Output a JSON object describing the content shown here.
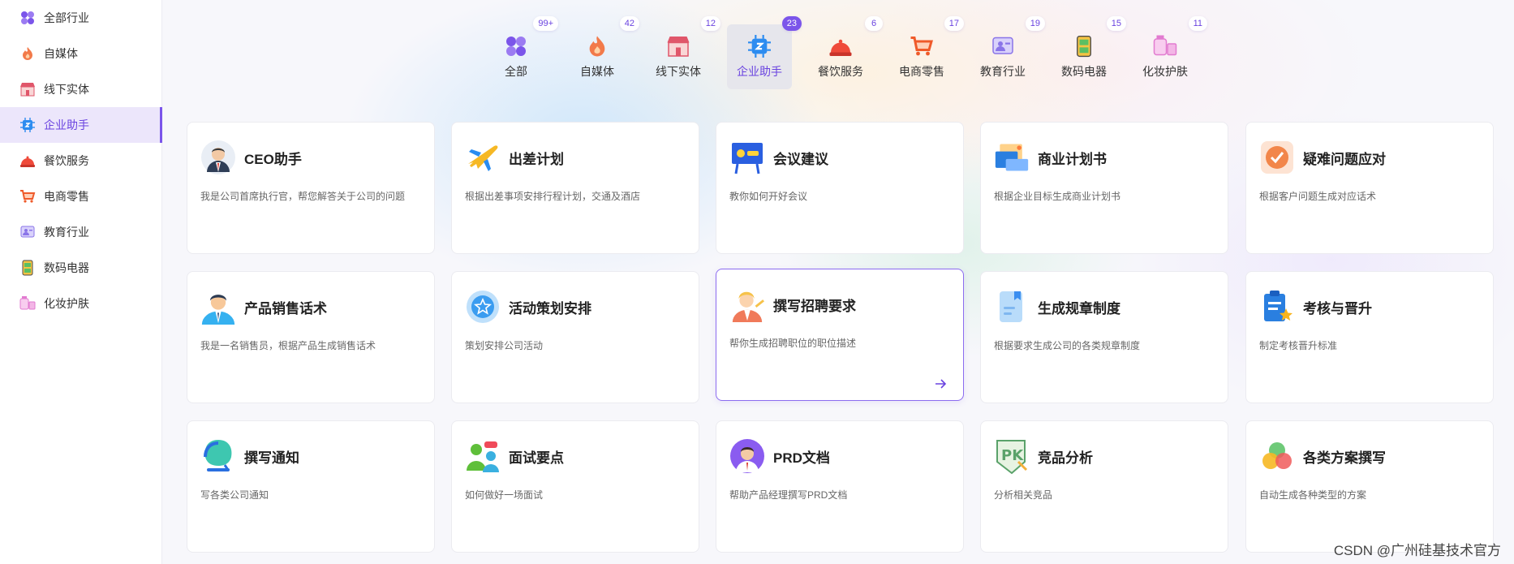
{
  "sidebar": {
    "items": [
      {
        "label": "全部行业",
        "icon": "grid-icon"
      },
      {
        "label": "自媒体",
        "icon": "flame-icon"
      },
      {
        "label": "线下实体",
        "icon": "store-icon"
      },
      {
        "label": "企业助手",
        "icon": "chip-icon",
        "active": true
      },
      {
        "label": "餐饮服务",
        "icon": "cloche-icon"
      },
      {
        "label": "电商零售",
        "icon": "cart-icon"
      },
      {
        "label": "教育行业",
        "icon": "education-icon"
      },
      {
        "label": "数码电器",
        "icon": "appliance-icon"
      },
      {
        "label": "化妆护肤",
        "icon": "cosmetics-icon"
      }
    ]
  },
  "tabs": [
    {
      "label": "全部",
      "count": "99+",
      "icon": "grid-icon"
    },
    {
      "label": "自媒体",
      "count": "42",
      "icon": "flame-icon"
    },
    {
      "label": "线下实体",
      "count": "12",
      "icon": "store-icon"
    },
    {
      "label": "企业助手",
      "count": "23",
      "icon": "chip-icon",
      "active": true
    },
    {
      "label": "餐饮服务",
      "count": "6",
      "icon": "cloche-icon"
    },
    {
      "label": "电商零售",
      "count": "17",
      "icon": "cart-icon"
    },
    {
      "label": "教育行业",
      "count": "19",
      "icon": "education-icon"
    },
    {
      "label": "数码电器",
      "count": "15",
      "icon": "appliance-icon"
    },
    {
      "label": "化妆护肤",
      "count": "11",
      "icon": "cosmetics-icon"
    }
  ],
  "cards": [
    {
      "title": "CEO助手",
      "desc": "我是公司首席执行官，帮您解答关于公司的问题",
      "icon": "ceo-avatar-icon"
    },
    {
      "title": "出差计划",
      "desc": "根据出差事项安排行程计划，交通及酒店",
      "icon": "airplane-icon"
    },
    {
      "title": "会议建议",
      "desc": "教你如何开好会议",
      "icon": "meeting-board-icon"
    },
    {
      "title": "商业计划书",
      "desc": "根据企业目标生成商业计划书",
      "icon": "business-plan-icon"
    },
    {
      "title": "疑难问题应对",
      "desc": "根据客户问题生成对应话术",
      "icon": "star-badge-icon"
    },
    {
      "title": "产品销售话术",
      "desc": "我是一名销售员，根据产品生成销售话术",
      "icon": "salesman-icon"
    },
    {
      "title": "活动策划安排",
      "desc": "策划安排公司活动",
      "icon": "event-star-icon"
    },
    {
      "title": "撰写招聘要求",
      "desc": "帮你生成招聘职位的职位描述",
      "icon": "recruiter-icon",
      "hover": true
    },
    {
      "title": "生成规章制度",
      "desc": "根据要求生成公司的各类规章制度",
      "icon": "rules-document-icon"
    },
    {
      "title": "考核与晋升",
      "desc": "制定考核晋升标准",
      "icon": "clipboard-star-icon"
    },
    {
      "title": "撰写通知",
      "desc": "写各类公司通知",
      "icon": "headset-icon"
    },
    {
      "title": "面试要点",
      "desc": "如何做好一场面试",
      "icon": "interview-icon"
    },
    {
      "title": "PRD文档",
      "desc": "帮助产品经理撰写PRD文档",
      "icon": "product-manager-icon"
    },
    {
      "title": "竞品分析",
      "desc": "分析相关竞品",
      "icon": "pk-icon"
    },
    {
      "title": "各类方案撰写",
      "desc": "自动生成各种类型的方案",
      "icon": "venn-circles-icon"
    }
  ],
  "watermark": "CSDN @广州硅基技术官方",
  "colors": {
    "accent": "#7b55ea",
    "active_bg": "#ece6fb",
    "card_border": "#ebebf0"
  }
}
